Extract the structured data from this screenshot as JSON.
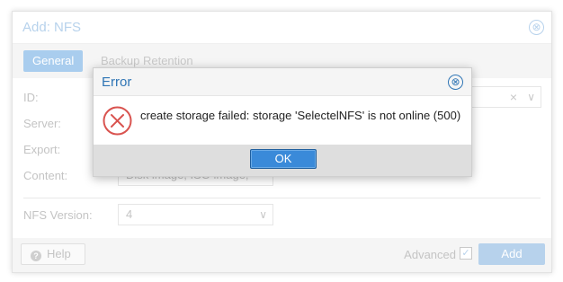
{
  "background_dialog": {
    "title": "Add: NFS",
    "close_glyph": "⊗",
    "tabs": [
      {
        "label": "General",
        "active": true
      },
      {
        "label": "Backup Retention",
        "active": false
      }
    ],
    "fields": {
      "id_label": "ID:",
      "server_label": "Server:",
      "export_label": "Export:",
      "content_label": "Content:",
      "content_value": "Disk image, ISO image,",
      "nfs_version_label": "NFS Version:",
      "nfs_version_value": "4"
    },
    "footer": {
      "help_label": "Help",
      "help_icon": "?",
      "advanced_label": "Advanced",
      "advanced_checked": true,
      "check_glyph": "✓",
      "add_label": "Add"
    }
  },
  "error_dialog": {
    "title": "Error",
    "close_glyph": "⊗",
    "message": "create storage failed: storage 'SelectelNFS' is not online (500)",
    "ok_label": "OK",
    "icon": "error-x-circle-icon"
  },
  "icons": {
    "chevron": "∨",
    "clear": "×"
  },
  "colors": {
    "accent": "#2f75b5",
    "error_red": "#d9534f",
    "ok_button": "#3a8ad9",
    "disabled_blue": "#b7d2ec"
  }
}
